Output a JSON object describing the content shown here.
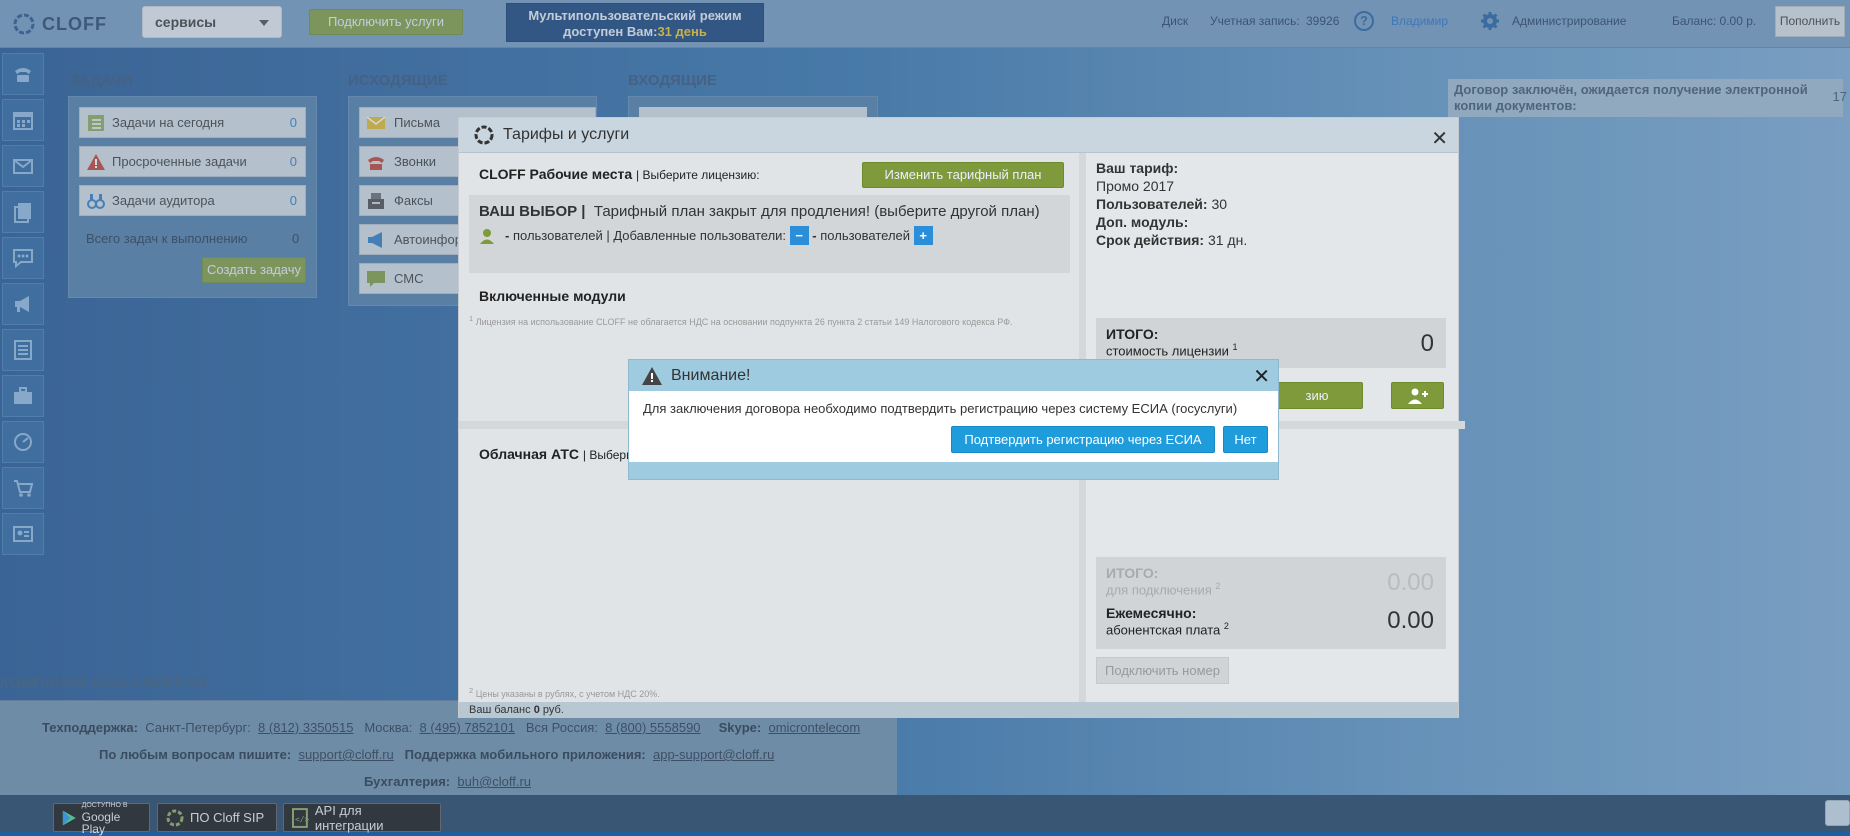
{
  "header": {
    "logo": "CLOFF",
    "service_select": "сервисы",
    "connect_services": "Подключить услуги",
    "multiuser_line1": "Мультипользовательский режим",
    "multiuser_line2_prefix": "доступен Вам:",
    "multiuser_days": "31 день",
    "disk": "Диск",
    "account_label": "Учетная запись:",
    "account_id": "39926",
    "user": "Владимир",
    "admin": "Администрирование",
    "balance": "Баланс: 0.00 р.",
    "topup": "Пополнить"
  },
  "sidebar": {
    "items": [
      "phone-icon",
      "calendar-icon",
      "mail-icon",
      "documents-icon",
      "chat-icon",
      "megaphone-icon",
      "list-icon",
      "briefcase-icon",
      "gauge-icon",
      "cart-icon",
      "contact-card-icon"
    ]
  },
  "sections": {
    "tasks": "ЗАДАЧИ",
    "outgoing": "ИСХОДЯЩИЕ",
    "incoming": "ВХОДЯЩИЕ"
  },
  "tasks": {
    "items": [
      {
        "label": "Задачи на сегодня",
        "count": "0"
      },
      {
        "label": "Просроченные задачи",
        "count": "0"
      },
      {
        "label": "Задачи аудитора",
        "count": "0"
      }
    ],
    "total_label": "Всего задач к выполнению",
    "total_count": "0",
    "create": "Создать задачу"
  },
  "outgoing": {
    "items": [
      "Письма",
      "Звонки",
      "Факсы",
      "Автоинфор",
      "СМС"
    ]
  },
  "right_note": {
    "text": "Договор заключён, ожидается получение электронной копии документов:",
    "num": "17"
  },
  "tariff": {
    "title": "Тарифы и услуги",
    "workplaces": "CLOFF Рабочие места",
    "choose_license": "| Выберите лицензию:",
    "change_plan": "Изменить тарифный план",
    "your_choice": "ВАШ ВЫБОР |",
    "plan_closed": "Тарифный план закрыт для продления!  (выберите другой план)",
    "users_dash": "-",
    "users_label": "пользователей | Добавленные пользователи:",
    "users_dash2": "-",
    "users_label2": "пользователей",
    "included_modules": "Включенные модули",
    "license_note": "Лицензия на использование CLOFF не облагается НДС на основании подпункта 26 пункта 2 статьи 149 Налогового кодекса РФ.",
    "cloud_pbx": "Облачная АТС",
    "choose_short": "| Выбери",
    "prices_note": "Цены указаны в рублях, с учетом НДС 20%.",
    "balance_prefix": "Ваш баланс",
    "balance_value": "0",
    "balance_suffix": "руб.",
    "your_tariff": "Ваш тариф:",
    "tariff_name": "Промо 2017",
    "users_k": "Пользователей:",
    "users_v": "30",
    "addon_k": "Доп. модуль:",
    "term_k": "Срок действия:",
    "term_v": "31 дн.",
    "itogo": "ИТОГО:",
    "license_cost": "стоимость лицензии",
    "license_total": "0",
    "partial_btn": "зию",
    "itogo2": "ИТОГО:",
    "connect_cost": "для подключения",
    "connect_total": "0.00",
    "monthly": "Ежемесячно:",
    "subscription": "абонентская плата",
    "monthly_total": "0.00",
    "connect_number": "Подключить номер"
  },
  "modal": {
    "title": "Внимание!",
    "text": "Для заключения договора необходимо подтвердить регистрацию через систему ЕСИА (госуслуги)",
    "confirm": "Подтвердить регистрацию через ЕСИА",
    "no": "Нет"
  },
  "footer": {
    "company": "КОМПАНИЯ ООО ОМИКРОН",
    "support_label": "Техподдержка:",
    "spb_label": "Санкт-Петербург:",
    "spb_phone": "8 (812) 3350515",
    "msk_label": "Москва:",
    "msk_phone": "8 (495) 7852101",
    "russia_label": "Вся Россия:",
    "russia_phone": "8 (800) 5558590",
    "skype_label": "Skype:",
    "skype": "omicrontelecom",
    "questions_label": "По любым вопросам пишите:",
    "support_email": "support@cloff.ru",
    "mobile_label": "Поддержка мобильного приложения:",
    "app_email": "app-support@cloff.ru",
    "accounting_label": "Бухгалтерия:",
    "accounting_email": "buh@cloff.ru"
  },
  "bottom": {
    "gplay_small": "ДОСТУПНО В",
    "gplay": "Google Play",
    "sip": "ПО Cloff SIP",
    "api": "API для интеграции"
  }
}
